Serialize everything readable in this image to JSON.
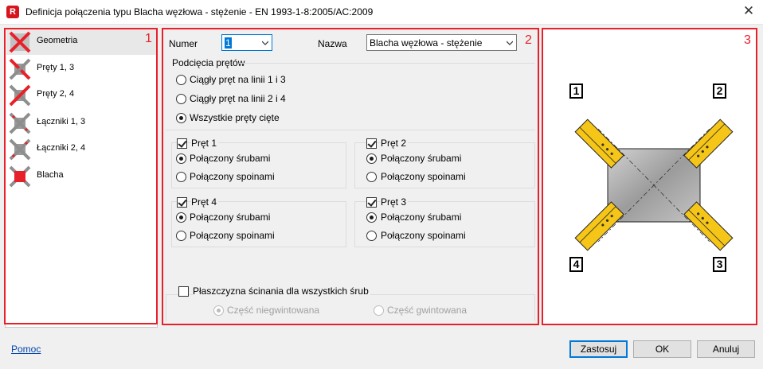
{
  "window": {
    "title": "Definicja połączenia typu Blacha węzłowa - stężenie  - EN 1993-1-8:2005/AC:2009",
    "app_icon_letter": "R",
    "close_icon": "close-icon"
  },
  "panel_numbers": {
    "p1": "1",
    "p2": "2",
    "p3": "3"
  },
  "sidebar": {
    "items": [
      {
        "label": "Geometria",
        "selected": true,
        "icon": "geometry-icon"
      },
      {
        "label": "Pręty 1, 3",
        "selected": false,
        "icon": "bars-1-3-icon"
      },
      {
        "label": "Pręty 2, 4",
        "selected": false,
        "icon": "bars-2-4-icon"
      },
      {
        "label": "Łączniki 1, 3",
        "selected": false,
        "icon": "connectors-1-3-icon"
      },
      {
        "label": "Łączniki 2, 4",
        "selected": false,
        "icon": "connectors-2-4-icon"
      },
      {
        "label": "Blacha",
        "selected": false,
        "icon": "plate-icon"
      }
    ]
  },
  "form": {
    "number_label": "Numer",
    "number_value": "1",
    "name_label": "Nazwa",
    "name_value": "Blacha węzłowa - stężenie",
    "cuts_title": "Podcięcia prętów",
    "cuts_options": [
      {
        "label": "Ciągły pręt na linii 1 i 3",
        "selected": false
      },
      {
        "label": "Ciągły pręt na linii 2 i 4",
        "selected": false
      },
      {
        "label": "Wszystkie pręty cięte",
        "selected": true
      }
    ],
    "bars": [
      {
        "label": "Pręt 1",
        "checked": true,
        "bolts_label": "Połączony śrubami",
        "welds_label": "Połączony spoinami",
        "bolts_selected": true
      },
      {
        "label": "Pręt 2",
        "checked": true,
        "bolts_label": "Połączony śrubami",
        "welds_label": "Połączony spoinami",
        "bolts_selected": true
      },
      {
        "label": "Pręt 4",
        "checked": true,
        "bolts_label": "Połączony śrubami",
        "welds_label": "Połączony spoinami",
        "bolts_selected": true
      },
      {
        "label": "Pręt 3",
        "checked": true,
        "bolts_label": "Połączony śrubami",
        "welds_label": "Połączony spoinami",
        "bolts_selected": true
      }
    ],
    "shear_plane_label": "Płaszczyzna ścinania dla wszystkich śrub",
    "shear_plane_checked": false,
    "unthreaded_label": "Część niegwintowana",
    "threaded_label": "Część gwintowana"
  },
  "drawing": {
    "corner_labels": [
      "1",
      "2",
      "4",
      "3"
    ],
    "colors": {
      "member": "#f5c518",
      "plate": "#b8b8b8",
      "outline": "#000000"
    }
  },
  "footer": {
    "help_label": "Pomoc",
    "apply_label": "Zastosuj",
    "ok_label": "OK",
    "cancel_label": "Anuluj"
  },
  "colors": {
    "accent_red": "#e8202a",
    "focus_blue": "#0078d7"
  }
}
